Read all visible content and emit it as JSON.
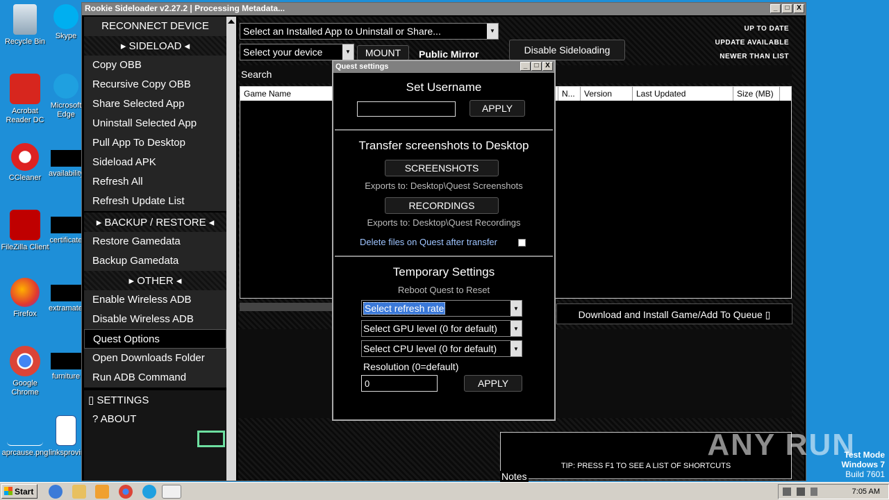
{
  "desktop": {
    "icons": [
      {
        "label": "Recycle Bin",
        "icon": "recycle-bin-icon"
      },
      {
        "label": "Skype",
        "icon": "skype-icon"
      },
      {
        "label": "Acrobat Reader DC",
        "icon": "acrobat-icon"
      },
      {
        "label": "Microsoft Edge",
        "icon": "edge-icon"
      },
      {
        "label": "CCleaner",
        "icon": "ccleaner-icon"
      },
      {
        "label": "availability",
        "icon": "file-icon"
      },
      {
        "label": "FileZilla Client",
        "icon": "filezilla-icon"
      },
      {
        "label": "certificate",
        "icon": "file-icon"
      },
      {
        "label": "Firefox",
        "icon": "firefox-icon"
      },
      {
        "label": "extramaterial",
        "icon": "file-icon"
      },
      {
        "label": "Google Chrome",
        "icon": "chrome-icon"
      },
      {
        "label": "furniture",
        "icon": "file-icon"
      },
      {
        "label": "aprcause.png",
        "icon": "image-icon"
      },
      {
        "label": "linksprovince",
        "icon": "word-icon"
      }
    ],
    "watermark": "ANY RUN",
    "test_mode": [
      "Test Mode",
      "Windows 7",
      "Build 7601"
    ]
  },
  "taskbar": {
    "start": "Start",
    "clock": "7:05 AM"
  },
  "window": {
    "title": "Rookie Sideloader v2.27.2 | Processing Metadata...",
    "min": "_",
    "max": "□",
    "close": "X"
  },
  "sidebar": {
    "reconnect": "RECONNECT DEVICE",
    "sideload_header": "▸ SIDELOAD ◂",
    "sideload_items": [
      "Copy OBB",
      "Recursive Copy OBB",
      "Share Selected App",
      "Uninstall Selected App",
      "Pull App To Desktop",
      "Sideload APK",
      "Refresh All",
      "Refresh Update List"
    ],
    "backup_header": "▸ BACKUP / RESTORE ◂",
    "backup_items": [
      "Restore Gamedata",
      "Backup Gamedata"
    ],
    "other_header": "▸ OTHER ◂",
    "other_items": [
      "Enable  Wireless ADB",
      "Disable Wireless ADB",
      "Quest Options",
      "Open Downloads Folder",
      "Run ADB Command"
    ],
    "settings": "▯ SETTINGS",
    "about": "?   ABOUT"
  },
  "main": {
    "installed_app_combo": "Select an Installed App to Uninstall or Share...",
    "device_combo": "Select your device",
    "mount_btn": "MOUNT",
    "mirror_label": "Public Mirror",
    "disable_sideloading_btn": "Disable Sideloading",
    "status_legend": [
      "UP TO DATE",
      "UPDATE AVAILABLE",
      "NEWER THAN LIST"
    ],
    "search_label": "Search",
    "columns": [
      "Game Name",
      "N...",
      "Version",
      "Last Updated",
      "Size (MB)"
    ],
    "download_btn": "Download  and  Install  Game/Add  To  Queue ▯",
    "tip": "TIP: PRESS F1 TO SEE A LIST OF SHORTCUTS",
    "notes_label": "Notes"
  },
  "dialog": {
    "title": "Quest settings",
    "min": "_",
    "max": "□",
    "close": "X",
    "username_heading": "Set Username",
    "username_value": "",
    "username_apply": "APPLY",
    "transfer_heading": "Transfer screenshots to Desktop",
    "screenshots_btn": "SCREENSHOTS",
    "screenshots_path": "Exports to: Desktop\\Quest Screenshots",
    "recordings_btn": "RECORDINGS",
    "recordings_path": "Exports to: Desktop\\Quest Recordings",
    "delete_files": "Delete files on Quest after transfer",
    "temp_heading": "Temporary Settings",
    "reboot_note": "Reboot Quest to Reset",
    "refresh_rate": "Select refresh rate",
    "gpu_level": "Select GPU level (0 for default)",
    "cpu_level": "Select CPU level (0 for default)",
    "resolution_label": "Resolution (0=default)",
    "resolution_value": "0",
    "resolution_apply": "APPLY"
  }
}
